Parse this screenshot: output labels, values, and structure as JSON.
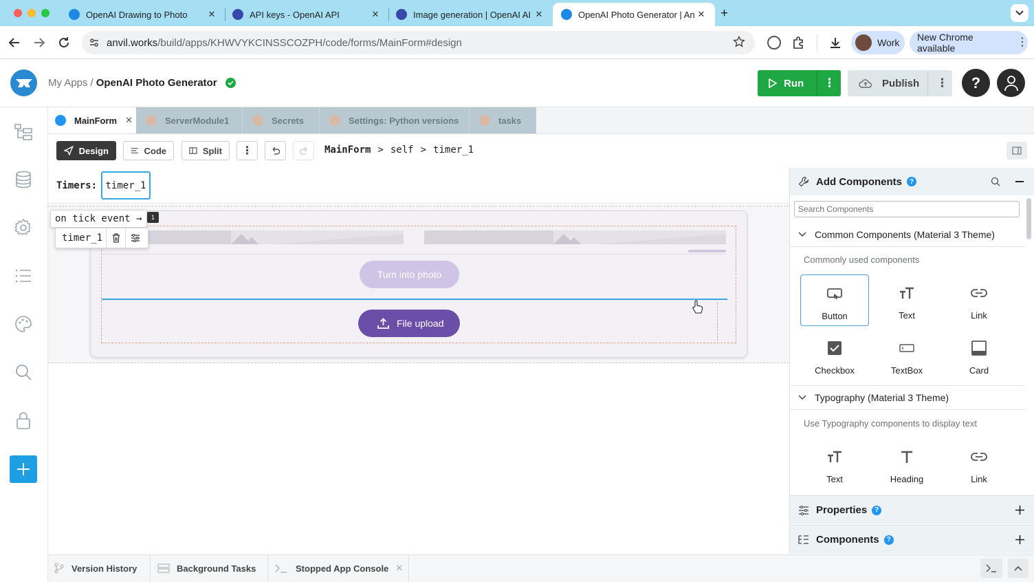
{
  "browser": {
    "tabs": [
      {
        "title": "OpenAI Drawing to Photo",
        "favicon_color": "#1e88e5"
      },
      {
        "title": "API keys - OpenAI API",
        "favicon_color": "#3949ab"
      },
      {
        "title": "Image generation | OpenAI AI",
        "favicon_color": "#3949ab"
      },
      {
        "title": "OpenAI Photo Generator | An",
        "favicon_color": "#1e88e5"
      }
    ],
    "url_host": "anvil.works",
    "url_path": "/build/apps/KHWVYKCINSSCOZPH/code/forms/MainForm#design",
    "profile_label": "Work",
    "update_label": "New Chrome available"
  },
  "anvil_header": {
    "breadcrumb_root": "My Apps",
    "breadcrumb_sep": "/",
    "app_name": "OpenAI Photo Generator",
    "run_label": "Run",
    "publish_label": "Publish"
  },
  "editor_tabs": [
    {
      "label": "MainForm",
      "active": true
    },
    {
      "label": "ServerModule1",
      "active": false
    },
    {
      "label": "Secrets",
      "active": false
    },
    {
      "label": "Settings: Python versions",
      "active": false
    },
    {
      "label": "tasks",
      "active": false
    }
  ],
  "toolbar": {
    "design_label": "Design",
    "code_label": "Code",
    "split_label": "Split",
    "path": [
      "MainForm",
      "self",
      "timer_1"
    ]
  },
  "canvas": {
    "timers_label": "Timers:",
    "timer_chip": "timer_1",
    "event_popup": "on tick event →",
    "timer_name": "timer_1",
    "badge": "1",
    "turn_button": "Turn into photo",
    "upload_button": "File upload"
  },
  "add_components": {
    "title": "Add Components",
    "search_placeholder": "Search Components",
    "sections": [
      {
        "title": "Common Components (Material 3 Theme)",
        "subtitle": "Commonly used components",
        "items": [
          {
            "label": "Button",
            "icon": "button-icon"
          },
          {
            "label": "Text",
            "icon": "text-icon"
          },
          {
            "label": "Link",
            "icon": "link-icon"
          },
          {
            "label": "Checkbox",
            "icon": "checkbox-icon"
          },
          {
            "label": "TextBox",
            "icon": "textbox-icon"
          },
          {
            "label": "Card",
            "icon": "card-icon"
          }
        ]
      },
      {
        "title": "Typography (Material 3 Theme)",
        "subtitle": "Use Typography components to display text",
        "items": [
          {
            "label": "Text",
            "icon": "text-icon"
          },
          {
            "label": "Heading",
            "icon": "heading-icon"
          },
          {
            "label": "Link",
            "icon": "link-icon"
          }
        ]
      }
    ]
  },
  "properties_title": "Properties",
  "components_title": "Components",
  "bottom_tabs": [
    "Version History",
    "Background Tasks",
    "Stopped App Console"
  ],
  "colors": {
    "run_green": "#1fa744",
    "upload_purple": "#6b4ea8",
    "turn_lavender": "#cfc3e6",
    "accent_blue": "#2196f3",
    "chrome_tabstrip": "#a6dff4"
  }
}
